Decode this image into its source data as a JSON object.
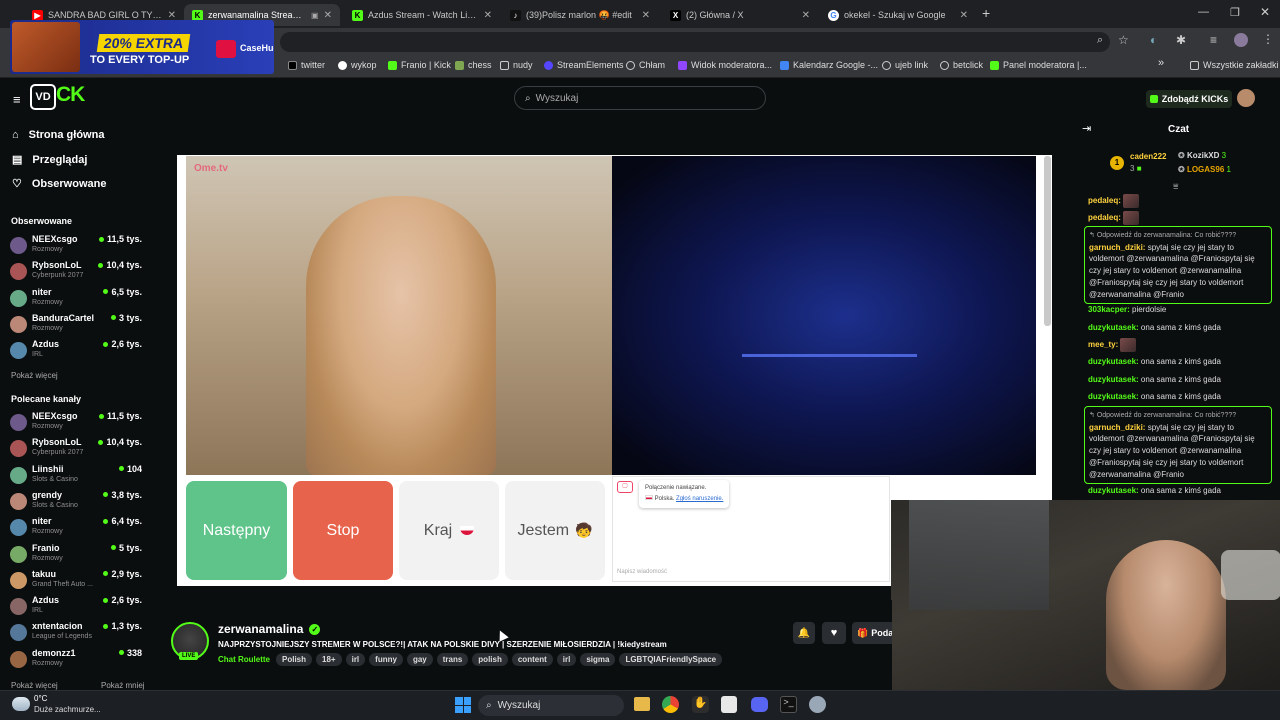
{
  "colors": {
    "kick_green": "#53fc18",
    "stop_red": "#e8634b",
    "next_green": "#5ec48a",
    "bg": "#0b0e0f"
  },
  "browser": {
    "tabs": [
      {
        "title": "SANDRA BAD GIRL O TYM JAK",
        "icon": "youtube-icon"
      },
      {
        "title": "zerwanamalina Stream - W",
        "icon": "kick-icon",
        "active": true
      },
      {
        "title": "Azdus Stream - Watch Live on K",
        "icon": "kick-icon"
      },
      {
        "title": "(39)Polisz marlon 🤬 #edit",
        "icon": "tiktok-icon"
      },
      {
        "title": "(2) Główna / X",
        "icon": "x-icon"
      },
      {
        "title": "okekel - Szukaj w Google",
        "icon": "google-icon"
      }
    ],
    "bookmarks": [
      "twitter",
      "wykop",
      "Franio | Kick",
      "chess",
      "nudy",
      "StreamElements",
      "Chłam",
      "Widok moderatora...",
      "Kalendarz Google -...",
      "ujeb link",
      "betclick",
      "Panel moderatora |..."
    ],
    "all_bookmarks": "Wszystkie zakładki"
  },
  "ad": {
    "line1": "20% EXTRA",
    "line2": "TO EVERY TOP-UP",
    "brand": "CaseHug"
  },
  "header": {
    "search_placeholder": "Wyszukaj",
    "kicks_button": "Zdobądź KICKs"
  },
  "sidebar": {
    "nav": [
      {
        "label": "Strona główna",
        "icon": "home-icon"
      },
      {
        "label": "Przeglądaj",
        "icon": "browse-icon"
      },
      {
        "label": "Obserwowane",
        "icon": "heart-icon"
      }
    ],
    "followed_title": "Obserwowane",
    "followed": [
      {
        "name": "NEEXcsgo",
        "cat": "Rozmowy",
        "viewers": "11,5 tys."
      },
      {
        "name": "RybsonLoL",
        "cat": "Cyberpunk 2077",
        "viewers": "10,4 tys."
      },
      {
        "name": "niter",
        "cat": "Rozmowy",
        "viewers": "6,5 tys."
      },
      {
        "name": "BanduraCartel",
        "cat": "Rozmowy",
        "viewers": "3 tys."
      },
      {
        "name": "Azdus",
        "cat": "IRL",
        "viewers": "2,6 tys."
      }
    ],
    "show_more": "Pokaż więcej",
    "recommended_title": "Polecane kanały",
    "recommended": [
      {
        "name": "NEEXcsgo",
        "cat": "Rozmowy",
        "viewers": "11,5 tys."
      },
      {
        "name": "RybsonLoL",
        "cat": "Cyberpunk 2077",
        "viewers": "10,4 tys."
      },
      {
        "name": "Liinshii",
        "cat": "Slots & Casino",
        "viewers": "104"
      },
      {
        "name": "grendy",
        "cat": "Slots & Casino",
        "viewers": "3,8 tys."
      },
      {
        "name": "niter",
        "cat": "Rozmowy",
        "viewers": "6,4 tys."
      },
      {
        "name": "Franio",
        "cat": "Rozmowy",
        "viewers": "5 tys."
      },
      {
        "name": "takuu",
        "cat": "Grand Theft Auto ...",
        "viewers": "2,9 tys."
      },
      {
        "name": "Azdus",
        "cat": "IRL",
        "viewers": "2,6 tys."
      },
      {
        "name": "xntentacion",
        "cat": "League of Legends",
        "viewers": "1,3 tys."
      },
      {
        "name": "demonzz1",
        "cat": "Rozmowy",
        "viewers": "338"
      }
    ],
    "show_more2": "Pokaż więcej",
    "show_less": "Pokaż mniej"
  },
  "omegle": {
    "watermark": "Ome.tv",
    "next": "Następny",
    "stop": "Stop",
    "country": "Kraj",
    "iam": "Jestem",
    "status1": "Połączenie nawiązane.",
    "status2_prefix": "Polska.",
    "report": "Zgłoś naruszenie.",
    "message_placeholder": "Napisz wiadomość"
  },
  "stream": {
    "channel": "zerwanamalina",
    "live": "LIVE",
    "title": "NAJPRZYSTOJNIEJSZY STREMER W POLSCE?!| ATAK NA POLSKIE DIVY | SZERZENIE MIŁOSIERDZIA | !kiedystream",
    "category": "Chat Roulette",
    "tags": [
      "Polish",
      "18+",
      "irl",
      "funny",
      "gay",
      "trans",
      "polish",
      "content",
      "irl",
      "sigma",
      "LGBTQIAFriendlySpace"
    ],
    "gift_label": "Poda"
  },
  "chat": {
    "title": "Czat",
    "leaderboard": [
      {
        "rank": "1",
        "name": "caden222",
        "count": "3"
      },
      {
        "name": "KozikXD",
        "count": "3"
      },
      {
        "name": "LOGAS96",
        "count": "1"
      }
    ],
    "messages": [
      {
        "user": "pedaleq:",
        "text": "",
        "emote": true
      },
      {
        "user": "pedaleq:",
        "text": "",
        "emote": true
      },
      {
        "reply_to": "Odpowiedź do zerwanamalina: Co robić????",
        "user": "garnuch_dziki:",
        "text": "spytaj się czy jej stary to voldemort @zerwanamalina @Franiospytaj się czy jej stary to voldemort @zerwanamalina @Franiospytaj się czy jej stary to voldemort @zerwanamalina @Franio"
      },
      {
        "user": "303kacper:",
        "text": "pierdolsie"
      },
      {
        "user": "duzykutasek:",
        "text": "ona sama z kimś gada"
      },
      {
        "user": "mee_ty:",
        "text": "",
        "emote": true
      },
      {
        "user": "duzykutasek:",
        "text": "ona sama z kimś gada"
      },
      {
        "user": "duzykutasek:",
        "text": "ona sama z kimś gada"
      },
      {
        "user": "duzykutasek:",
        "text": "ona sama z kimś gada"
      },
      {
        "reply_to": "Odpowiedź do zerwanamalina: Co robić????",
        "user": "garnuch_dziki:",
        "text": "spytaj się czy jej stary to voldemort @zerwanamalina @Franiospytaj się czy jej stary to voldemort @zerwanamalina @Franiospytaj się czy jej stary to voldemort @zerwanamalina @Franio"
      },
      {
        "user": "duzykutasek:",
        "text": "ona sama z kimś gada"
      }
    ]
  },
  "taskbar": {
    "temp": "0°C",
    "weather": "Duże zachmurze...",
    "search": "Wyszukaj"
  }
}
